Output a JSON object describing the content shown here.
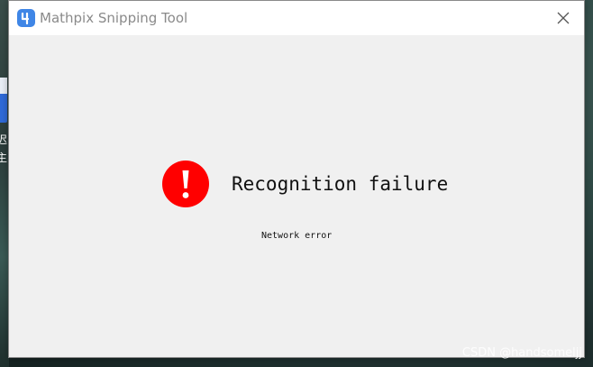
{
  "window": {
    "title": "Mathpix Snipping Tool",
    "logo_icon": "mathpix-logo-icon",
    "close_icon": "close-icon"
  },
  "message": {
    "title": "Recognition failure",
    "detail": "Network error",
    "icon": "error-exclamation-icon",
    "icon_color": "#ff0000"
  },
  "desktop": {
    "partial_text": [
      "迟图",
      "主系"
    ]
  },
  "watermark": "CSDN @handsomeljj",
  "colors": {
    "accent": "#3f86e6",
    "window_bg": "#f0f0f0",
    "titlebar_bg": "#ffffff"
  }
}
